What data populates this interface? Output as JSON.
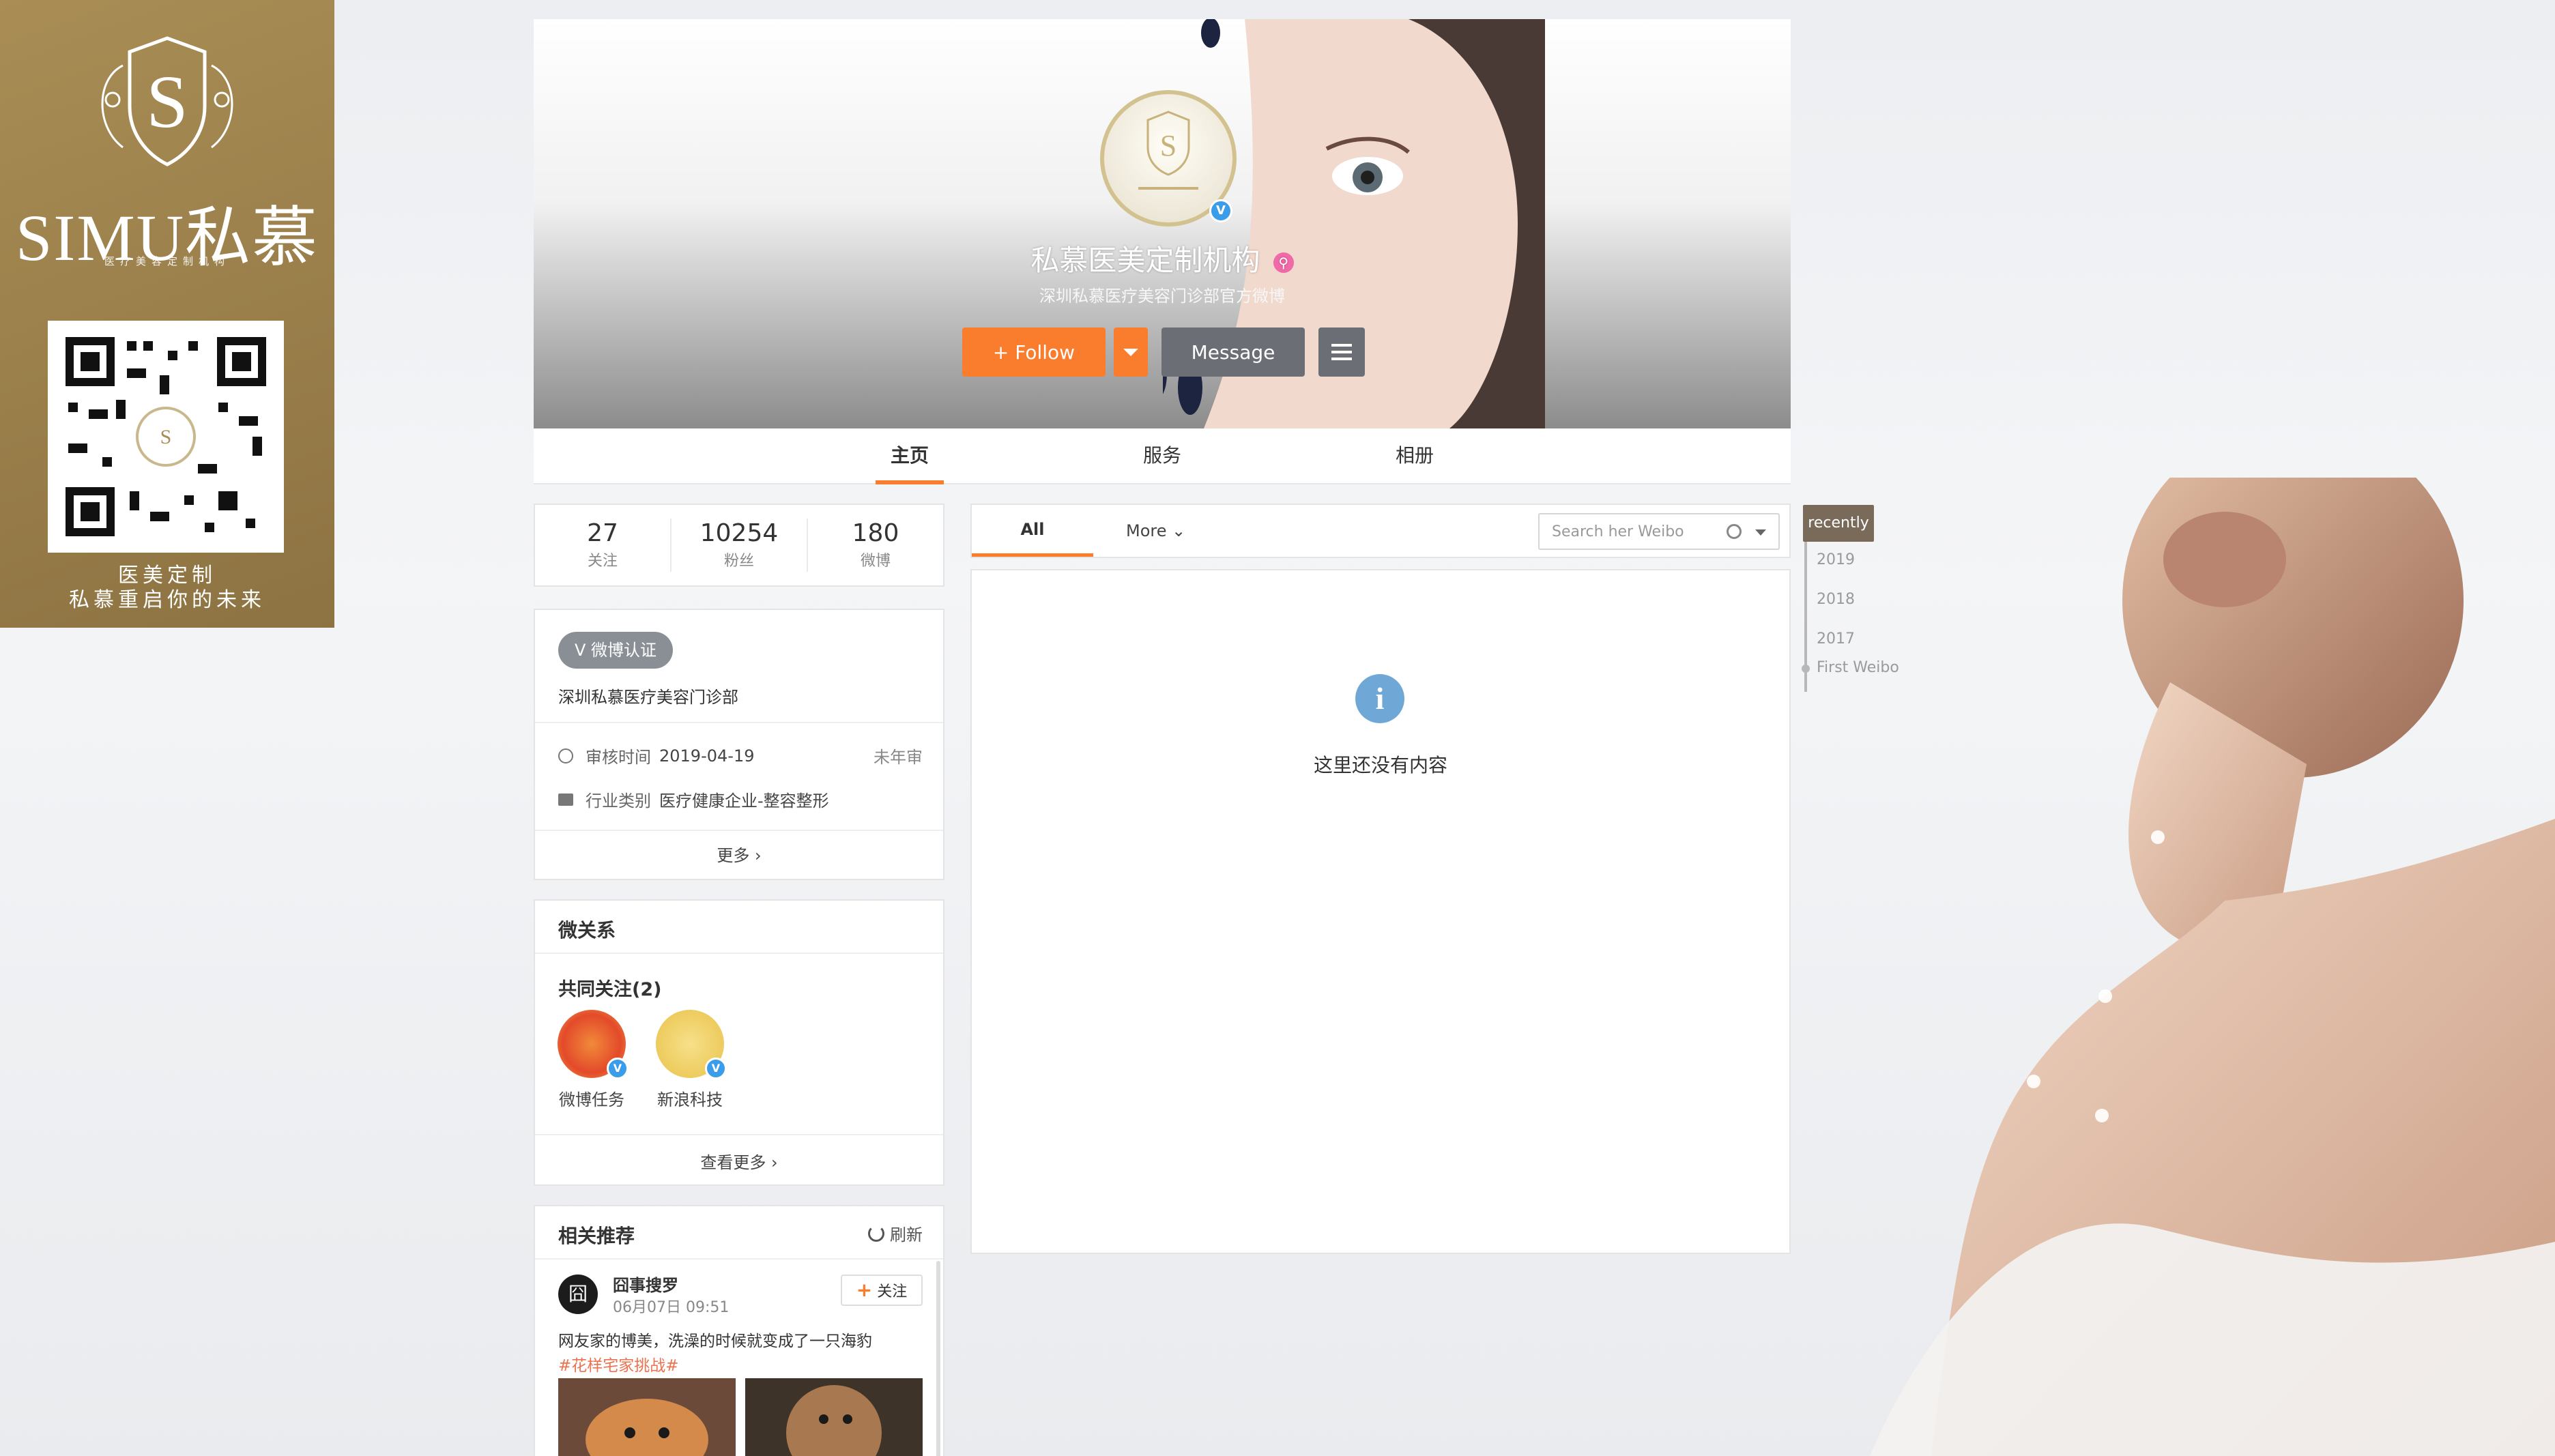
{
  "brand": {
    "name": "SIMU私慕",
    "subtitle": "医疗美容定制机构",
    "tagline_line1": "医美定制",
    "tagline_line2": "私慕重启你的未来"
  },
  "profile": {
    "name": "私慕医美定制机构",
    "description": "深圳私慕医疗美容门诊部官方微博",
    "follow_label": "+ Follow",
    "message_label": "Message",
    "verify_mark": "V"
  },
  "tabs": [
    "主页",
    "服务",
    "相册"
  ],
  "stats": [
    {
      "num": "27",
      "label": "关注"
    },
    {
      "num": "10254",
      "label": "粉丝"
    },
    {
      "num": "180",
      "label": "微博"
    }
  ],
  "info": {
    "badge": "V 微博认证",
    "org_name": "深圳私慕医疗美容门诊部",
    "review_label": "审核时间",
    "review_date": "2019-04-19",
    "review_status": "未年审",
    "industry_label": "行业类别",
    "industry_value": "医疗健康企业-整容整形",
    "more": "更多 ›"
  },
  "relations": {
    "title": "微关系",
    "mutual_title": "共同关注(2)",
    "friends": [
      {
        "name": "微博任务"
      },
      {
        "name": "新浪科技"
      }
    ],
    "more": "查看更多 ›"
  },
  "recommend": {
    "title": "相关推荐",
    "refresh": "刷新",
    "user": "囧事搜罗",
    "time": "06月07日 09:51",
    "follow": "关注",
    "text": "网友家的博美，洗澡的时候就变成了一只海豹",
    "tag": "#花样宅家挑战#",
    "avatar_char": "囧"
  },
  "feed": {
    "all_tab": "All",
    "more_tab": "More",
    "search_placeholder": "Search her Weibo",
    "empty_text": "这里还没有内容",
    "empty_icon": "i"
  },
  "timeline": {
    "current": "recently",
    "years": [
      "2019",
      "2018",
      "2017"
    ],
    "first": "First Weibo"
  },
  "colors": {
    "accent": "#fa7d2d",
    "brand_gold": "#a98d55",
    "verify_blue": "#3b9cea"
  }
}
